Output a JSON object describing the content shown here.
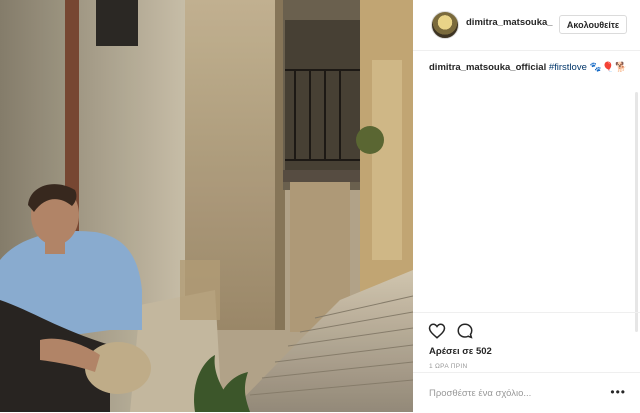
{
  "post": {
    "username": "dimitra_matsouka_",
    "follow_label": "Ακολουθείτε",
    "caption_user": "dimitra_matsouka_official",
    "caption_hashtag": "#firstlove",
    "caption_emojis": "🐾🎈🐕",
    "likes": "Αρέσει σε 502",
    "time": "1 ΩΡΑ ΠΡΙΝ",
    "comment_placeholder": "Προσθέστε ένα σχόλιο...",
    "more": "•••"
  },
  "icons": {
    "like": "heart-icon",
    "comment": "comment-icon",
    "more": "more-icon"
  }
}
